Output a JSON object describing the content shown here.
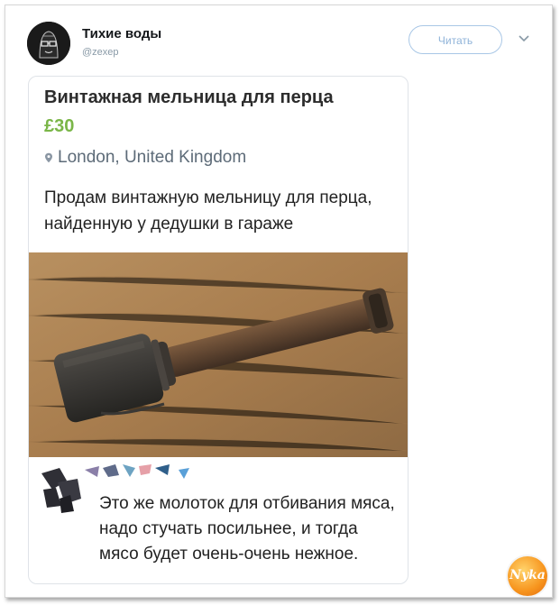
{
  "tweet": {
    "author_name": "Тихие воды",
    "author_handle": "@zexep",
    "follow_label": "Читать"
  },
  "listing": {
    "title": "Винтажная мельница для перца",
    "price": "£30",
    "location": "London, United Kingdom",
    "description": "Продам винтажную мельницу для перца, найденную у дедушки в гараже"
  },
  "reply": {
    "text": "Это же молоток для отбивания мяса, надо стучать посильнее, и тогда мясо будет очень-очень нежное."
  },
  "watermark": {
    "text": "Nykа"
  }
}
